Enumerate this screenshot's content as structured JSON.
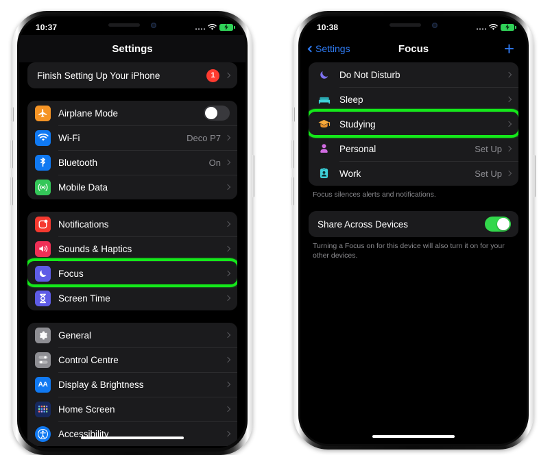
{
  "colors": {
    "highlight_green": "#14e81a",
    "accent_blue": "#2f7cf6",
    "toggle_on_green": "#32d74b",
    "badge_red": "#ff3b30",
    "group_bg": "#1b1b1d",
    "secondary_text": "#8e8e93"
  },
  "left_phone": {
    "status_bar": {
      "time": "10:37",
      "wifi_icon": "wifi-icon",
      "battery_icon": "battery-charging-icon"
    },
    "nav": {
      "title": "Settings"
    },
    "banner": {
      "label": "Finish Setting Up Your iPhone",
      "badge": "1"
    },
    "group_connectivity": [
      {
        "label": "Airplane Mode",
        "icon": "airplane-icon",
        "value": "",
        "control": "toggle",
        "toggle_on": false
      },
      {
        "label": "Wi-Fi",
        "icon": "wifi-icon",
        "value": "Deco P7",
        "control": "chevron"
      },
      {
        "label": "Bluetooth",
        "icon": "bluetooth-icon",
        "value": "On",
        "control": "chevron"
      },
      {
        "label": "Mobile Data",
        "icon": "mobile-data-icon",
        "value": "",
        "control": "chevron"
      }
    ],
    "group_alerts": [
      {
        "label": "Notifications",
        "icon": "notifications-icon",
        "value": "",
        "control": "chevron",
        "highlighted": false
      },
      {
        "label": "Sounds & Haptics",
        "icon": "sounds-haptics-icon",
        "value": "",
        "control": "chevron",
        "highlighted": false
      },
      {
        "label": "Focus",
        "icon": "focus-moon-icon",
        "value": "",
        "control": "chevron",
        "highlighted": true
      },
      {
        "label": "Screen Time",
        "icon": "screen-time-icon",
        "value": "",
        "control": "chevron",
        "highlighted": false
      }
    ],
    "group_system": [
      {
        "label": "General",
        "icon": "gear-icon",
        "value": "",
        "control": "chevron"
      },
      {
        "label": "Control Centre",
        "icon": "control-centre-icon",
        "value": "",
        "control": "chevron"
      },
      {
        "label": "Display & Brightness",
        "icon": "display-brightness-icon",
        "value": "",
        "control": "chevron"
      },
      {
        "label": "Home Screen",
        "icon": "home-screen-icon",
        "value": "",
        "control": "chevron"
      },
      {
        "label": "Accessibility",
        "icon": "accessibility-icon",
        "value": "",
        "control": "chevron"
      }
    ]
  },
  "right_phone": {
    "status_bar": {
      "time": "10:38",
      "wifi_icon": "wifi-icon",
      "battery_icon": "battery-charging-icon"
    },
    "nav": {
      "back_label": "Settings",
      "title": "Focus",
      "add_label": "+"
    },
    "focus_list": [
      {
        "label": "Do Not Disturb",
        "icon": "crescent-moon-icon",
        "value": "",
        "highlighted": false
      },
      {
        "label": "Sleep",
        "icon": "bed-icon",
        "value": "",
        "highlighted": false
      },
      {
        "label": "Studying",
        "icon": "graduation-cap-icon",
        "value": "",
        "highlighted": true
      },
      {
        "label": "Personal",
        "icon": "person-icon",
        "value": "Set Up",
        "highlighted": false
      },
      {
        "label": "Work",
        "icon": "work-badge-icon",
        "value": "Set Up",
        "highlighted": false
      }
    ],
    "focus_caption": "Focus silences alerts and notifications.",
    "share": {
      "label": "Share Across Devices",
      "toggle_on": true
    },
    "share_caption": "Turning a Focus on for this device will also turn it on for your other devices."
  }
}
